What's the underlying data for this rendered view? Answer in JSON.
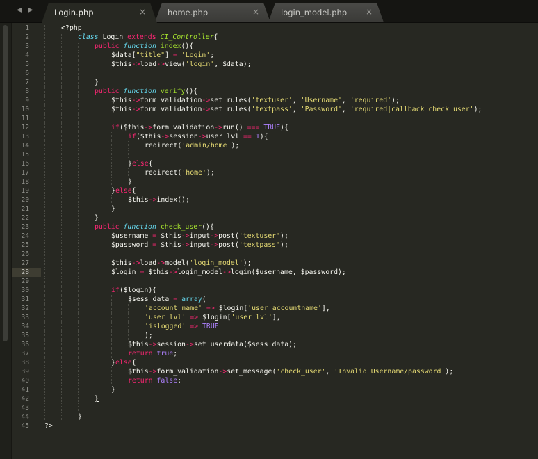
{
  "tabs": [
    {
      "label": "Login.php",
      "active": true
    },
    {
      "label": "home.php",
      "active": false
    },
    {
      "label": "login_model.php",
      "active": false
    }
  ],
  "nav": {
    "back": "◀",
    "forward": "▶"
  },
  "close_glyph": "×",
  "current_line": 28,
  "matched_bracket_line": 42,
  "colors": {
    "background": "#272822",
    "keyword": "#f92672",
    "string": "#e6db74",
    "function": "#a6e22e",
    "storage": "#66d9ef",
    "constant": "#ae81ff"
  },
  "lines": [
    {
      "indent": 1,
      "text": "<?php"
    },
    {
      "indent": 2,
      "text": "class Login extends CI_Controller{"
    },
    {
      "indent": 3,
      "text": "public function index(){"
    },
    {
      "indent": 4,
      "text": "$data[\"title\"] = 'Login';"
    },
    {
      "indent": 4,
      "text": "$this->load->view('login', $data);"
    },
    {
      "indent": 4,
      "text": ""
    },
    {
      "indent": 3,
      "text": "}"
    },
    {
      "indent": 3,
      "text": "public function verify(){"
    },
    {
      "indent": 4,
      "text": "$this->form_validation->set_rules('textuser', 'Username', 'required');"
    },
    {
      "indent": 4,
      "text": "$this->form_validation->set_rules('textpass', 'Password', 'required|callback_check_user');"
    },
    {
      "indent": 4,
      "text": ""
    },
    {
      "indent": 4,
      "text": "if($this->form_validation->run() === TRUE){"
    },
    {
      "indent": 5,
      "text": "if($this->session->user_lvl == 1){"
    },
    {
      "indent": 6,
      "text": "redirect('admin/home');"
    },
    {
      "indent": 6,
      "text": ""
    },
    {
      "indent": 5,
      "text": "}else{"
    },
    {
      "indent": 6,
      "text": "redirect('home');"
    },
    {
      "indent": 5,
      "text": "}"
    },
    {
      "indent": 4,
      "text": "}else{"
    },
    {
      "indent": 5,
      "text": "$this->index();"
    },
    {
      "indent": 4,
      "text": "}"
    },
    {
      "indent": 3,
      "text": "}"
    },
    {
      "indent": 3,
      "text": "public function check_user(){"
    },
    {
      "indent": 4,
      "text": "$username = $this->input->post('textuser');"
    },
    {
      "indent": 4,
      "text": "$password = $this->input->post('textpass');"
    },
    {
      "indent": 4,
      "text": ""
    },
    {
      "indent": 4,
      "text": "$this->load->model('login_model');"
    },
    {
      "indent": 4,
      "text": "$login = $this->login_model->login($username, $password);"
    },
    {
      "indent": 4,
      "text": ""
    },
    {
      "indent": 4,
      "text": "if($login){"
    },
    {
      "indent": 5,
      "text": "$sess_data = array("
    },
    {
      "indent": 6,
      "text": "'account_name' => $login['user_accountname'],"
    },
    {
      "indent": 6,
      "text": "'user_lvl' => $login['user_lvl'],"
    },
    {
      "indent": 6,
      "text": "'islogged' => TRUE"
    },
    {
      "indent": 6,
      "text": ");"
    },
    {
      "indent": 5,
      "text": "$this->session->set_userdata($sess_data);"
    },
    {
      "indent": 5,
      "text": "return true;"
    },
    {
      "indent": 4,
      "text": "}else{"
    },
    {
      "indent": 5,
      "text": "$this->form_validation->set_message('check_user', 'Invalid Username/password');"
    },
    {
      "indent": 5,
      "text": "return false;"
    },
    {
      "indent": 4,
      "text": "}"
    },
    {
      "indent": 3,
      "text": "}"
    },
    {
      "indent": 3,
      "text": ""
    },
    {
      "indent": 2,
      "text": "}"
    },
    {
      "indent": 0,
      "text": "?>"
    }
  ]
}
